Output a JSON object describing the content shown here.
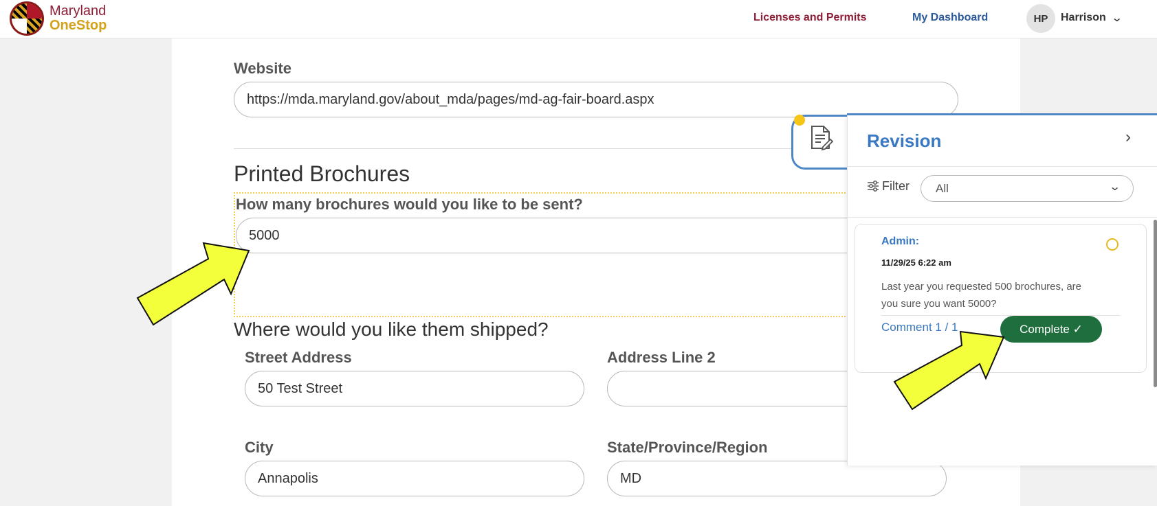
{
  "header": {
    "logo_line1": "Maryland",
    "logo_line2": "OneStop",
    "nav_licenses": "Licenses and Permits",
    "nav_dashboard": "My Dashboard",
    "user_initials": "HP",
    "user_name": "Harrison",
    "user_chevron": "⌄"
  },
  "form": {
    "website_label": "Website",
    "website_value": "https://mda.maryland.gov/about_mda/pages/md-ag-fair-board.aspx",
    "brochures_title": "Printed Brochures",
    "brochures_question": "How many brochures would you like to be sent?",
    "brochures_value": "5000",
    "shipping_title": "Where would you like them shipped?",
    "street_label": "Street Address",
    "street_value": "50 Test Street",
    "address2_label": "Address Line 2",
    "address2_value": "",
    "city_label": "City",
    "city_value": "Annapolis",
    "state_label": "State/Province/Region",
    "state_value": "MD"
  },
  "revision_panel": {
    "title": "Revision",
    "close_glyph": "›",
    "filter_label": "Filter",
    "filter_value": "All",
    "comment": {
      "author": "Admin:",
      "timestamp": "11/29/25 6:22 am",
      "text": "Last year you requested 500 brochures, are you sure you want 5000?",
      "counter": "Comment 1 / 1",
      "complete_label": "Complete ✓"
    }
  },
  "colors": {
    "brand_maroon": "#8e1d35",
    "brand_gold": "#d5a21c",
    "accent_blue": "#3a78c2",
    "complete_green": "#1f6e3d",
    "annotation_arrow": "#f4ff3c"
  },
  "icons": [
    "maryland-seal-logo",
    "chevron-down-icon",
    "document-edit-icon",
    "chevron-right-icon",
    "filter-sliders-icon",
    "status-circle-icon",
    "checkmark-icon",
    "annotation-arrow"
  ]
}
